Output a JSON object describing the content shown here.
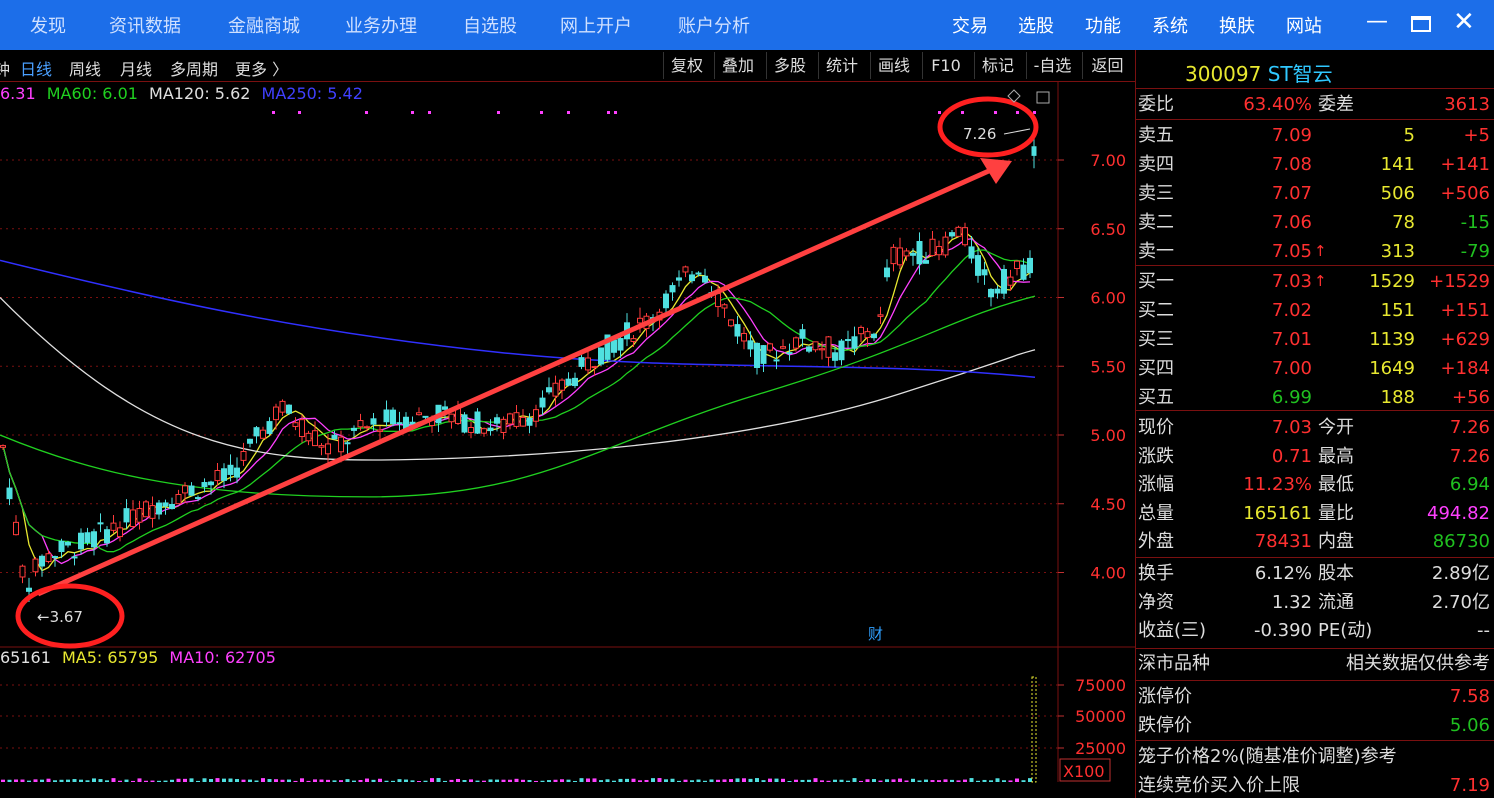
{
  "topnav": {
    "items": [
      "发现",
      "资讯数据",
      "金融商城",
      "业务办理",
      "自选股",
      "网上开户",
      "账户分析"
    ],
    "right": [
      "交易",
      "选股",
      "功能",
      "系统",
      "换肤",
      "网站"
    ]
  },
  "subnav": {
    "left": [
      "钟",
      "日线",
      "周线",
      "月线",
      "多周期",
      "更多 〉"
    ],
    "buttons": [
      "复权",
      "叠加",
      "多股",
      "统计",
      "画线",
      "F10",
      "标记",
      "-自选",
      "返回"
    ]
  },
  "ma_legend": {
    "ma20": "6.31",
    "ma60": "MA60: 6.01",
    "ma120": "MA120: 5.62",
    "ma250": "MA250: 5.42"
  },
  "vol_legend": {
    "vol": "65161",
    "ma5": "MA5: 65795",
    "ma10": "MA10: 62705"
  },
  "annotations": {
    "high": "7.26",
    "low": "3.67",
    "cai": "财",
    "x100": "X100"
  },
  "price_axis": [
    "7.00",
    "6.50",
    "6.00",
    "5.50",
    "5.00",
    "4.50",
    "4.00"
  ],
  "vol_axis": [
    "75000",
    "50000",
    "25000"
  ],
  "stock": {
    "code": "300097",
    "name": "ST智云"
  },
  "weibi": {
    "label": "委比",
    "value": "63.40%",
    "label2": "委差",
    "value2": "3613"
  },
  "sell": [
    {
      "label": "卖五",
      "price": "7.09",
      "vol": "5",
      "chg": "+5"
    },
    {
      "label": "卖四",
      "price": "7.08",
      "vol": "141",
      "chg": "+141"
    },
    {
      "label": "卖三",
      "price": "7.07",
      "vol": "506",
      "chg": "+506"
    },
    {
      "label": "卖二",
      "price": "7.06",
      "vol": "78",
      "chg": "-15"
    },
    {
      "label": "卖一",
      "price": "7.05",
      "vol": "313",
      "chg": "-79"
    }
  ],
  "buy": [
    {
      "label": "买一",
      "price": "7.03",
      "vol": "1529",
      "chg": "+1529"
    },
    {
      "label": "买二",
      "price": "7.02",
      "vol": "151",
      "chg": "+151"
    },
    {
      "label": "买三",
      "price": "7.01",
      "vol": "1139",
      "chg": "+629"
    },
    {
      "label": "买四",
      "price": "7.00",
      "vol": "1649",
      "chg": "+184"
    },
    {
      "label": "买五",
      "price": "6.99",
      "vol": "188",
      "chg": "+56"
    }
  ],
  "quote": [
    {
      "l1": "现价",
      "v1": "7.03",
      "l2": "今开",
      "v2": "7.26"
    },
    {
      "l1": "涨跌",
      "v1": "0.71",
      "l2": "最高",
      "v2": "7.26"
    },
    {
      "l1": "涨幅",
      "v1": "11.23%",
      "l2": "最低",
      "v2": "6.94"
    },
    {
      "l1": "总量",
      "v1": "165161",
      "l2": "量比",
      "v2": "494.82"
    },
    {
      "l1": "外盘",
      "v1": "78431",
      "l2": "内盘",
      "v2": "86730"
    }
  ],
  "fund": [
    {
      "l1": "换手",
      "v1": "6.12%",
      "l2": "股本",
      "v2": "2.89亿"
    },
    {
      "l1": "净资",
      "v1": "1.32",
      "l2": "流通",
      "v2": "2.70亿"
    },
    {
      "l1": "收益(三)",
      "v1": "-0.390",
      "l2": "PE(动)",
      "v2": "--"
    }
  ],
  "market": {
    "label": "深市品种",
    "note": "相关数据仅供参考"
  },
  "limits": [
    {
      "label": "涨停价",
      "value": "7.58"
    },
    {
      "label": "跌停价",
      "value": "5.06"
    }
  ],
  "cage": {
    "text": "笼子价格2%(随基准价调整)参考",
    "label": "连续竞价买入价上限",
    "value": "7.19"
  }
}
